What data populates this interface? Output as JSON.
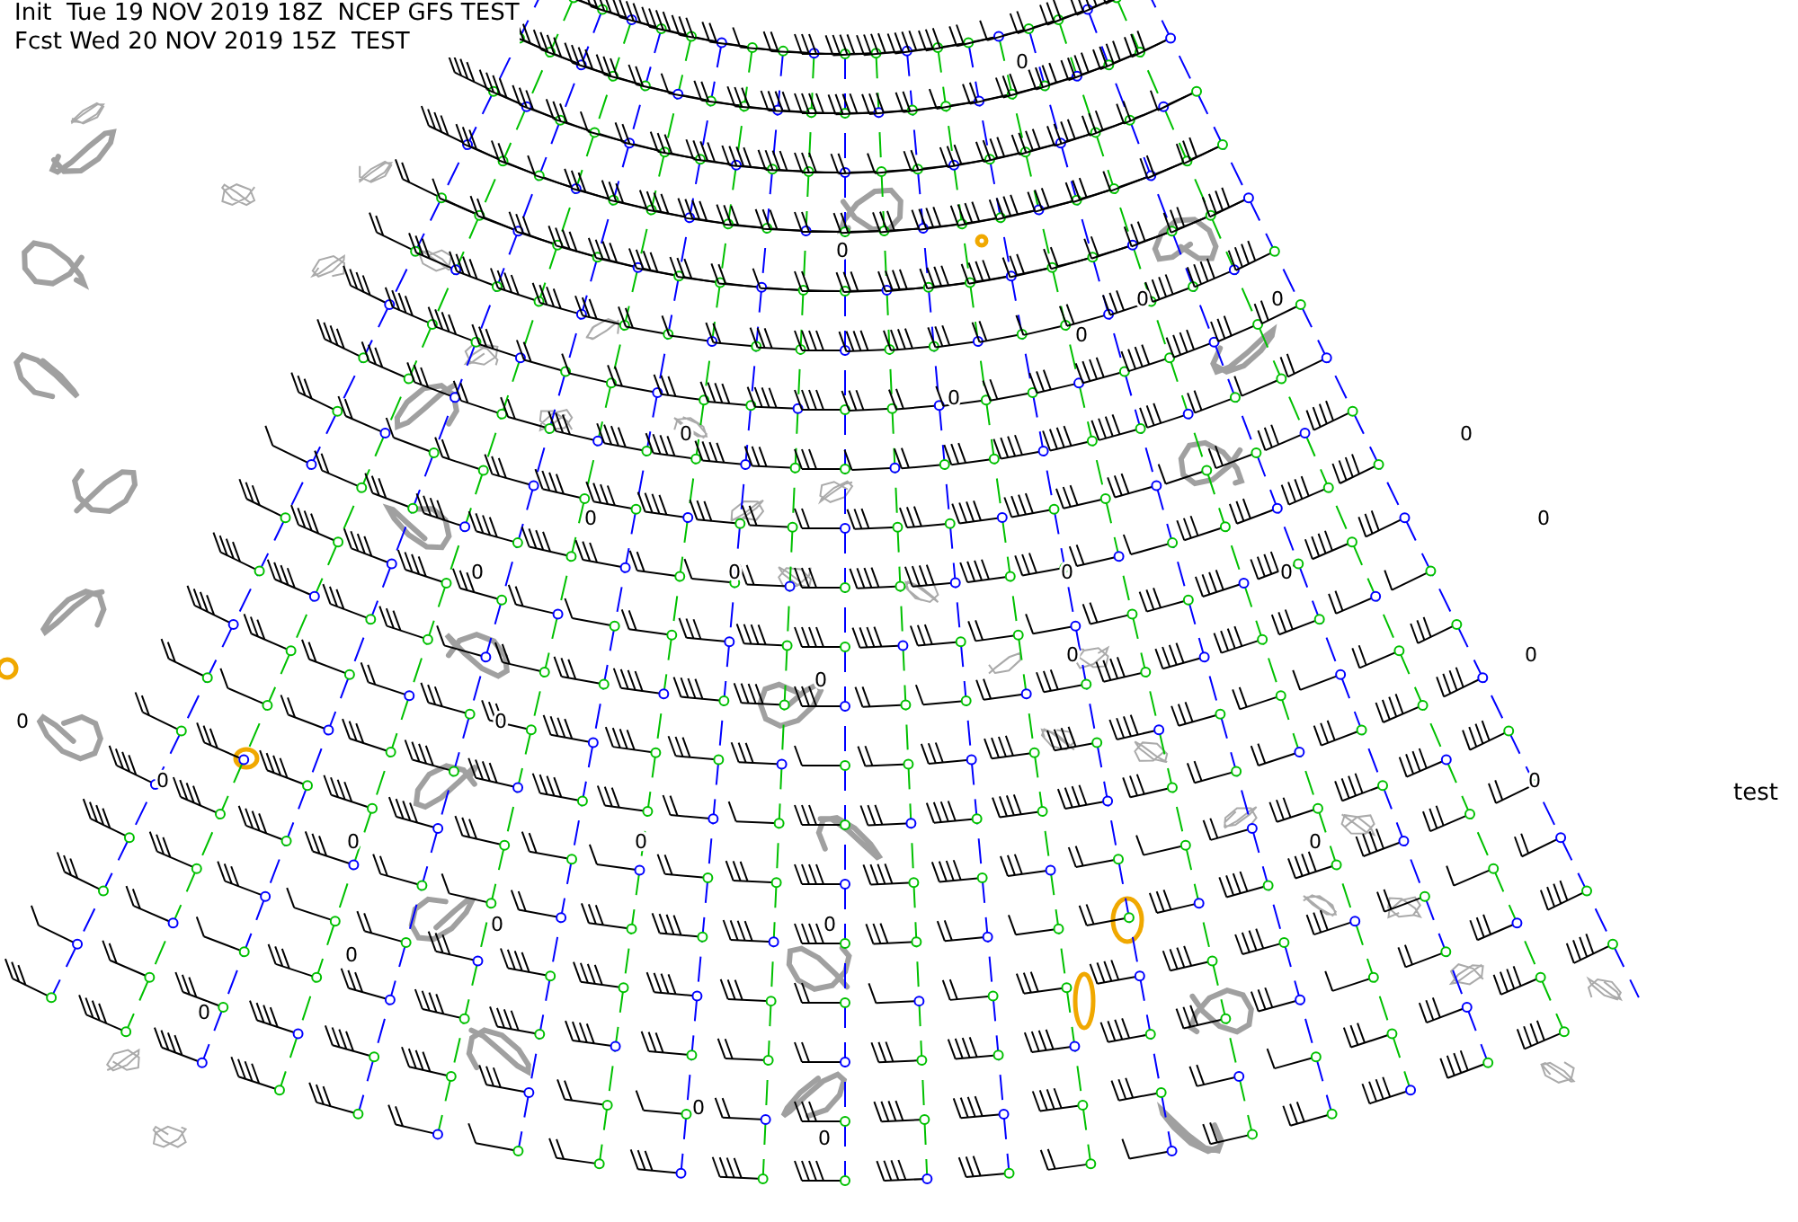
{
  "header": {
    "init_line": "Init  Tue 19 NOV 2019 18Z  NCEP GFS TEST",
    "forecast_line": "Fcst Wed 20 NOV 2019 15Z  TEST"
  },
  "map": {
    "contour_labels": [
      "0",
      "0",
      "0",
      "0",
      "0",
      "0",
      "0",
      "0",
      "0",
      "0",
      "0",
      "0",
      "0",
      "0",
      "0",
      "0",
      "0",
      "0",
      "0",
      "0",
      "0",
      "0",
      "0",
      "0",
      "0",
      "0",
      "0",
      "0",
      "0",
      "0"
    ]
  },
  "side_label": "test"
}
